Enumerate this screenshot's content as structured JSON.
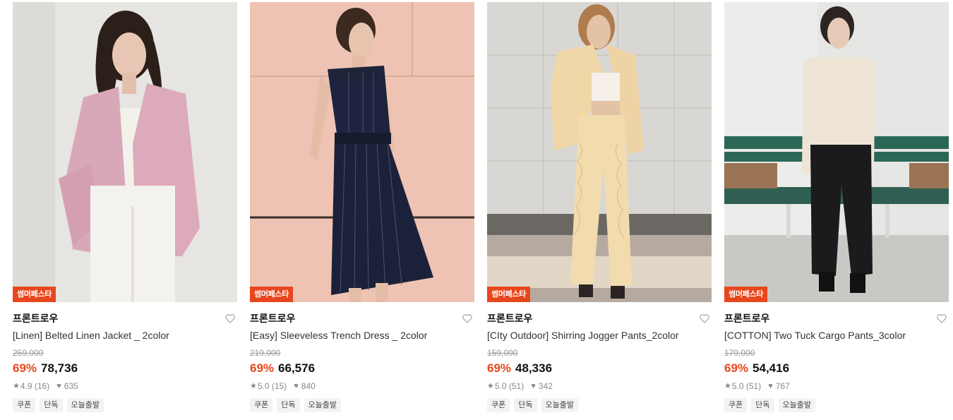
{
  "products": [
    {
      "promo": "썸머페스타",
      "brand": "프론트로우",
      "name": "[Linen] Belted Linen Jacket _ 2color",
      "original_price": "259,000",
      "discount": "69%",
      "sale_price": "78,736",
      "rating": "4.9 (16)",
      "likes": "635",
      "tags": [
        "쿠폰",
        "단독",
        "오늘출발"
      ],
      "photo_bg": "#e7e6e3"
    },
    {
      "promo": "썸머페스타",
      "brand": "프론트로우",
      "name": "[Easy] Sleeveless Trench Dress _ 2color",
      "original_price": "219,000",
      "discount": "69%",
      "sale_price": "66,576",
      "rating": "5.0 (15)",
      "likes": "840",
      "tags": [
        "쿠폰",
        "단독",
        "오늘출발"
      ],
      "photo_bg": "#ecc1b2"
    },
    {
      "promo": "썸머페스타",
      "brand": "프론트로우",
      "name": "[CIty Outdoor] Shirring Jogger Pants_2color",
      "original_price": "159,000",
      "discount": "69%",
      "sale_price": "48,336",
      "rating": "5.0 (51)",
      "likes": "342",
      "tags": [
        "쿠폰",
        "단독",
        "오늘출발"
      ],
      "photo_bg": "#d8d6d2"
    },
    {
      "promo": "썸머페스타",
      "brand": "프론트로우",
      "name": "[COTTON] Two Tuck Cargo Pants_3color",
      "original_price": "179,000",
      "discount": "69%",
      "sale_price": "54,416",
      "rating": "5.0 (51)",
      "likes": "767",
      "tags": [
        "쿠폰",
        "단독",
        "오늘출발"
      ],
      "photo_bg": "#e4e4e2"
    }
  ],
  "colors": {
    "accent": "#e8461c",
    "tag_bg": "#f3f3f3"
  }
}
